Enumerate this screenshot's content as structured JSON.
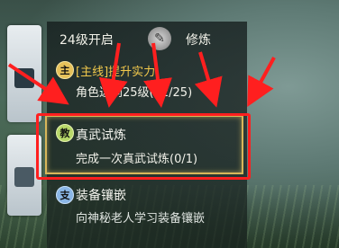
{
  "header": {
    "level_label": "24级开启",
    "emblem_glyph": "✎",
    "cultivation_label": "修炼"
  },
  "quests": [
    {
      "icon_char": "主",
      "title": "[主线]提升实力",
      "desc": "角色达到25级(22/25)"
    },
    {
      "icon_char": "教",
      "title": "真武试炼",
      "desc": "完成一次真武试炼(0/1)"
    },
    {
      "icon_char": "支",
      "title": "装备镶嵌",
      "desc": "向神秘老人学习装备镶嵌"
    }
  ],
  "colors": {
    "highlight": "#ff1f1f",
    "main_quest": "#f2c94c",
    "frame": "#d8b65a"
  }
}
